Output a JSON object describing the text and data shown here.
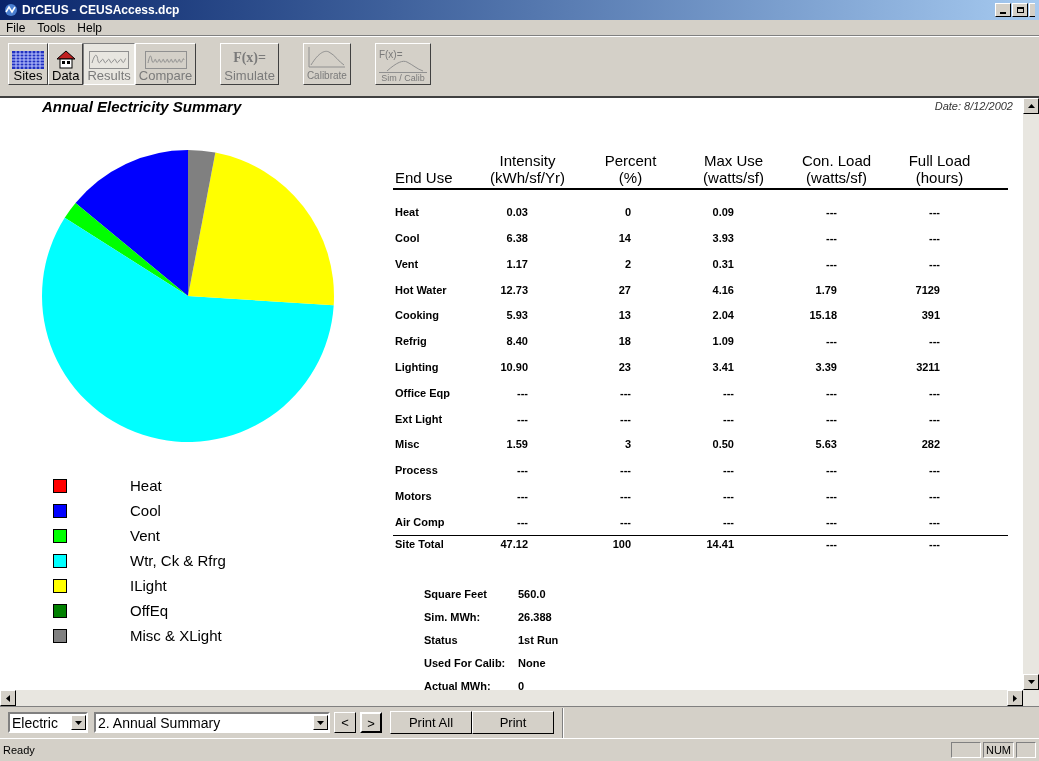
{
  "window": {
    "title": "DrCEUS - CEUSAccess.dcp"
  },
  "menu": [
    "File",
    "Tools",
    "Help"
  ],
  "toolbar": [
    {
      "kind": "grid",
      "label": "Sites",
      "disabled": false,
      "selected": false
    },
    {
      "kind": "house",
      "label": "Data",
      "disabled": false,
      "selected": false
    },
    {
      "kind": "wave",
      "label": "Results",
      "disabled": true,
      "selected": true
    },
    {
      "kind": "wave2",
      "label": "Compare",
      "disabled": true,
      "selected": false
    },
    {
      "kind": "formula",
      "top": "F(x)=",
      "label": "Simulate",
      "disabled": true,
      "selected": false
    },
    {
      "kind": "curve",
      "label": "Calibrate",
      "disabled": true,
      "selected": false
    },
    {
      "kind": "formula-curve",
      "top": "F(x)=",
      "label": "Sim / Calib",
      "disabled": true,
      "selected": false
    }
  ],
  "report": {
    "title": "Annual Electricity Summary",
    "date": "Date: 8/12/2002",
    "chart_data": {
      "type": "pie",
      "categories": [
        "Heat",
        "Cool",
        "Vent",
        "Wtr, Ck & Rfrg",
        "ILight",
        "OffEq",
        "Misc & XLight"
      ],
      "values": [
        0,
        14,
        2,
        58,
        23,
        0,
        3
      ]
    },
    "legend": [
      {
        "color": "#ff0000"
      },
      {
        "color": "#0000ff"
      },
      {
        "color": "#00ff00"
      },
      {
        "color": "#00ffff"
      },
      {
        "color": "#ffff00"
      },
      {
        "color": "#008000"
      },
      {
        "color": "#808080"
      }
    ],
    "table": {
      "columns": [
        "End Use",
        "Intensity\n(kWh/sf/Yr)",
        "Percent\n(%)",
        "Max Use\n(watts/sf)",
        "Con. Load\n(watts/sf)",
        "Full Load\n(hours)"
      ],
      "rows": [
        [
          "Heat",
          "0.03",
          "0",
          "0.09",
          "---",
          "---"
        ],
        [
          "Cool",
          "6.38",
          "14",
          "3.93",
          "---",
          "---"
        ],
        [
          "Vent",
          "1.17",
          "2",
          "0.31",
          "---",
          "---"
        ],
        [
          "Hot Water",
          "12.73",
          "27",
          "4.16",
          "1.79",
          "7129"
        ],
        [
          "Cooking",
          "5.93",
          "13",
          "2.04",
          "15.18",
          "391"
        ],
        [
          "Refrig",
          "8.40",
          "18",
          "1.09",
          "---",
          "---"
        ],
        [
          "Lighting",
          "10.90",
          "23",
          "3.41",
          "3.39",
          "3211"
        ],
        [
          "Office Eqp",
          "---",
          "---",
          "---",
          "---",
          "---"
        ],
        [
          "Ext Light",
          "---",
          "---",
          "---",
          "---",
          "---"
        ],
        [
          "Misc",
          "1.59",
          "3",
          "0.50",
          "5.63",
          "282"
        ],
        [
          "Process",
          "---",
          "---",
          "---",
          "---",
          "---"
        ],
        [
          "Motors",
          "---",
          "---",
          "---",
          "---",
          "---"
        ],
        [
          "Air Comp",
          "---",
          "---",
          "---",
          "---",
          "---"
        ]
      ],
      "total": [
        "Site Total",
        "47.12",
        "100",
        "14.41",
        "---",
        "---"
      ]
    },
    "info": [
      {
        "label": "Square Feet",
        "value": "560.0"
      },
      {
        "label": "Sim. MWh:",
        "value": "26.388"
      },
      {
        "label": "Status",
        "value": "1st Run"
      },
      {
        "label": "Used For Calib:",
        "value": "None"
      },
      {
        "label": "Actual MWh:",
        "value": "0"
      }
    ]
  },
  "bottom_bar": {
    "fuel": "Electric",
    "report": "2. Annual Summary",
    "nav": [
      "<",
      ">"
    ],
    "buttons": [
      "Print All",
      "Print"
    ]
  },
  "status_bar": {
    "text": "Ready",
    "panels": [
      "NUM"
    ]
  }
}
